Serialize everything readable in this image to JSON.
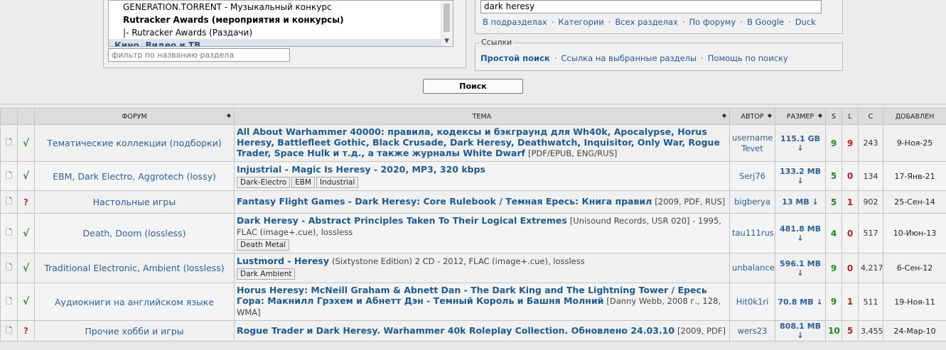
{
  "sections": {
    "options": [
      {
        "label": "GENERATION.TORRENT - Музыкальный конкурс",
        "kind": "sub"
      },
      {
        "label": "Rutracker Awards (мероприятия и конкурсы)",
        "kind": "bold"
      },
      {
        "label": "|- Rutracker Awards (Раздачи)",
        "kind": "sub"
      },
      {
        "label": "Кино, Видео и ТВ",
        "kind": "cat"
      }
    ],
    "filter_placeholder": "фильтр по названию раздела"
  },
  "search": {
    "query": "dark heresy",
    "links": [
      "В подразделах",
      "Категории",
      "Всех разделах",
      "По форуму",
      "В Google",
      "Duck"
    ],
    "button": "Поиск"
  },
  "links_box": {
    "legend": "Ссылки",
    "simple": "Простой поиск",
    "selected": "Ссылка на выбранные разделы",
    "help": "Помощь по поиску"
  },
  "table": {
    "headers": {
      "forum": "ФОРУМ",
      "topic": "ТЕМА",
      "author": "АВТОР",
      "size": "РАЗМЕР",
      "s": "S",
      "l": "L",
      "c": "C",
      "added": "ДОБАВЛЕН"
    },
    "rows": [
      {
        "status": "√",
        "status_kind": "ok",
        "forum": "Тематические коллекции (подборки)",
        "title": "All About Warhammer 40000: правила, кодексы и бэкграунд для Wh40k, Apocalypse, Horus Heresy, Battlefleet Gothic, Black Crusade, Dark Heresy, Deathwatch, Inquisitor, Only War, Rogue Trader, Space Hulk и т.д., а также журналы White Dwarf",
        "extra": "[PDF/EPUB, ENG/RUS]",
        "tags": [],
        "author": "username Tevet",
        "size": "115.1 GB ↓",
        "s": "9",
        "l": "9",
        "c": "243",
        "added": "9-Ноя-25"
      },
      {
        "status": "√",
        "status_kind": "ok",
        "forum": "EBM, Dark Electro, Aggrotech (lossy)",
        "title": "Injustrial - Magic Is Heresy - 2020, MP3, 320 kbps",
        "extra": "",
        "tags": [
          "Dark-Electro",
          "EBM",
          "Industrial"
        ],
        "author": "Serj76",
        "size": "133.2 MB ↓",
        "s": "5",
        "l": "0",
        "c": "134",
        "added": "17-Янв-21"
      },
      {
        "status": "?",
        "status_kind": "q",
        "forum": "Настольные игры",
        "title": "Fantasy Flight Games - Dark Heresy: Core Rulebook / Темная Ересь: Книга правил",
        "extra": "[2009, PDF, RUS]",
        "tags": [],
        "author": "bigberya",
        "size": "13 MB ↓",
        "s": "5",
        "l": "1",
        "c": "902",
        "added": "25-Сен-14"
      },
      {
        "status": "√",
        "status_kind": "ok",
        "forum": "Death, Doom (lossless)",
        "title": "Dark Heresy - Abstract Principles Taken To Their Logical Extremes",
        "extra": "[Unisound Records, USR 020] - 1995, FLAC (image+.cue), lossless",
        "tags": [
          "Death Metal"
        ],
        "author": "tau111rus",
        "size": "481.8 MB ↓",
        "s": "4",
        "l": "0",
        "c": "517",
        "added": "10-Июн-13"
      },
      {
        "status": "√",
        "status_kind": "ok",
        "forum": "Traditional Electronic, Ambient (lossless)",
        "title": "Lustmord - Heresy",
        "extra": "(Sixtystone Edition) 2 CD - 2012, FLAC (image+.cue), lossless",
        "tags": [
          "Dark Ambient"
        ],
        "author": "unbalance",
        "size": "596.1 MB ↓",
        "s": "9",
        "l": "0",
        "c": "4,217",
        "added": "6-Сен-12"
      },
      {
        "status": "√",
        "status_kind": "ok",
        "forum": "Аудиокниги на английском языке",
        "title": "Horus Heresy: McNeill Graham & Abnett Dan - The Dark King and The Lightning Tower / Ересь Гора: Макнилл Грэхем и Абнетт Дэн - Темный Король и Башня Молний",
        "extra": "[Danny Webb, 2008 г., 128, WMA]",
        "tags": [],
        "author": "Hit0k1ri",
        "size": "70.8 MB ↓",
        "s": "9",
        "l": "1",
        "c": "511",
        "added": "19-Ноя-11"
      },
      {
        "status": "?",
        "status_kind": "q",
        "forum": "Прочие хобби и игры",
        "title": "Rogue Trader и Dark Heresy. Warhammer 40k Roleplay Collection. Обновлено 24.03.10",
        "extra": "[2009, PDF]",
        "tags": [],
        "author": "wers23",
        "size": "808.1 MB ↓",
        "s": "10",
        "l": "5",
        "c": "3,455",
        "added": "24-Мар-10"
      }
    ]
  }
}
